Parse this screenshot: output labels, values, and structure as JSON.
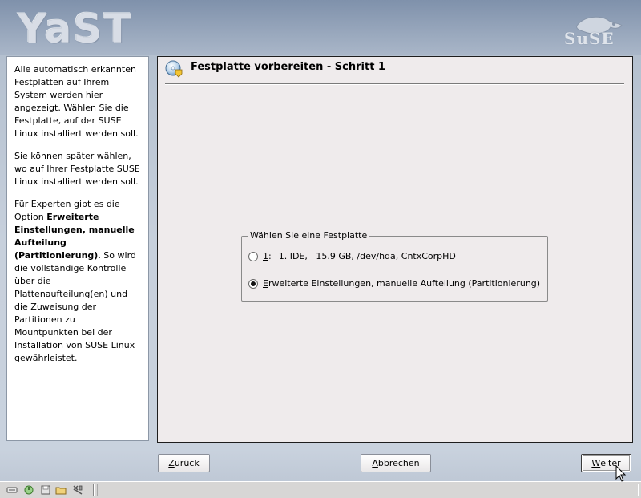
{
  "header": {
    "logo_text": "YaST",
    "brand_text": "SuSE"
  },
  "help": {
    "paragraph1": "Alle automatisch erkannten Festplatten auf Ihrem System werden hier angezeigt. Wählen Sie die Festplatte, auf der SUSE Linux installiert werden soll.",
    "paragraph2": "Sie können später wählen, wo auf Ihrer Festplatte SUSE Linux installiert werden soll.",
    "paragraph3_prefix": "Für Experten gibt es die Option ",
    "paragraph3_bold": "Erweiterte Einstellungen, manuelle Aufteilung (Partitionierung)",
    "paragraph3_suffix": ". So wird die vollständige Kontrolle über die Plattenaufteilung(en) und die Zuweisung der Partitionen zu Mountpunkten bei der Installation von SUSE Linux gewährleistet."
  },
  "main": {
    "title": "Festplatte vorbereiten - Schritt 1",
    "title_icon": "disk-setup-icon",
    "group": {
      "title": "Wählen Sie eine Festplatte",
      "options": [
        {
          "shortcut": "1",
          "suffix": ":",
          "label": "1. IDE,   15.9 GB, /dev/hda, CntxCorpHD",
          "checked": false
        },
        {
          "shortcut": "E",
          "label": "rweiterte Einstellungen, manuelle Aufteilung (Partitionierung)",
          "checked": true
        }
      ]
    }
  },
  "buttons": {
    "back": {
      "shortcut": "Z",
      "rest": "urück"
    },
    "cancel": {
      "shortcut": "A",
      "rest": "bbrechen"
    },
    "next": {
      "shortcut": "W",
      "rest": "eiter"
    }
  },
  "taskbar": {
    "icons": [
      "keyboard-icon",
      "power-icon",
      "floppy-icon",
      "folder-icon",
      "settings-icon"
    ]
  },
  "colors": {
    "panel_bg": "#efebec",
    "header_bg": "#8e9fb5"
  }
}
